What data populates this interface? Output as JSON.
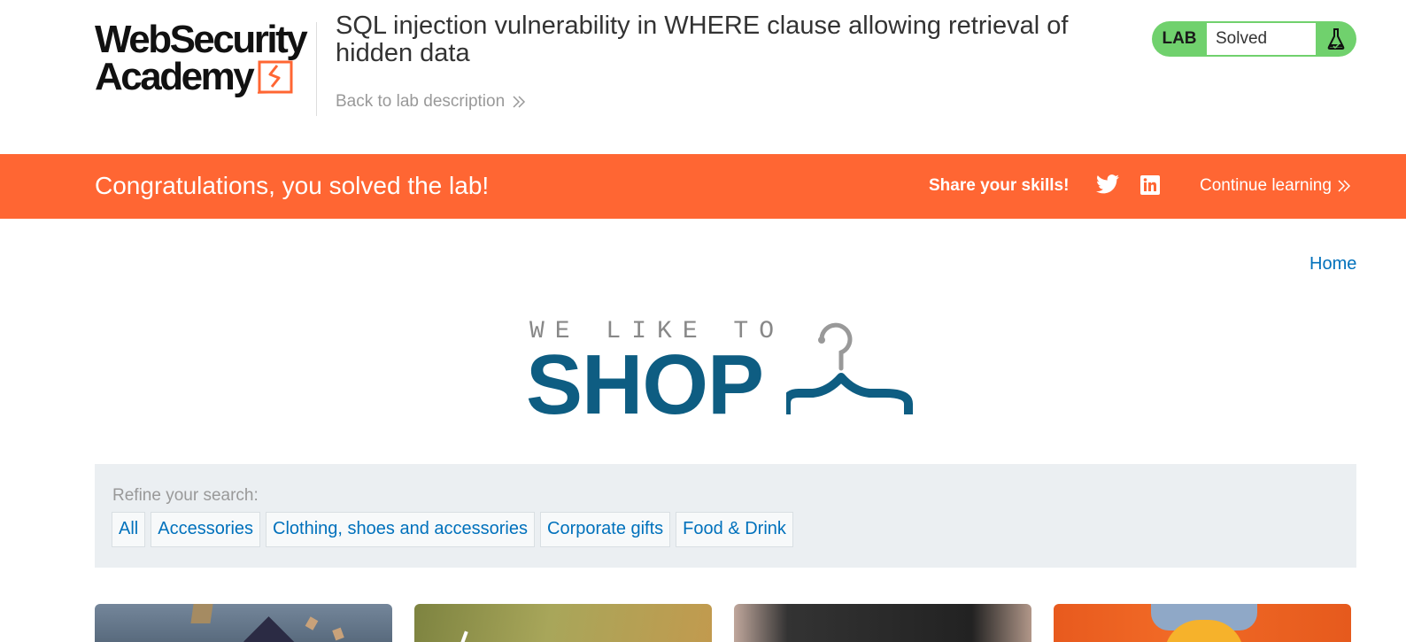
{
  "header": {
    "logo_line1": "WebSecurity",
    "logo_line2": "Academy",
    "lab_title": "SQL injection vulnerability in WHERE clause allowing retrieval of hidden data",
    "back_link": "Back to lab description",
    "lab_status": {
      "tag": "LAB",
      "status": "Solved",
      "icon": "flask-icon",
      "color": "#70d16d"
    }
  },
  "banner": {
    "message": "Congratulations, you solved the lab!",
    "share_label": "Share your skills!",
    "social_icons": [
      "twitter-icon",
      "linkedin-icon"
    ],
    "continue_link": "Continue learning",
    "color": "#ff6633"
  },
  "nav": {
    "home": "Home"
  },
  "hero": {
    "tagline": "WE LIKE TO",
    "title": "SHOP",
    "icon": "hanger-icon",
    "color": "#0e5d82"
  },
  "filter": {
    "label": "Refine your search:",
    "categories": [
      "All",
      "Accessories",
      "Clothing, shoes and accessories",
      "Corporate gifts",
      "Food & Drink"
    ]
  },
  "products": [
    {
      "image": "product-image-1"
    },
    {
      "image": "product-image-2"
    },
    {
      "image": "product-image-3"
    },
    {
      "image": "product-image-4"
    }
  ]
}
